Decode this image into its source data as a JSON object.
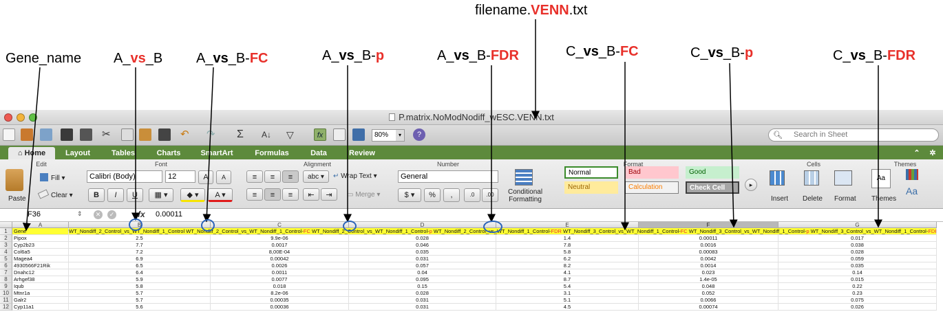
{
  "annotations": {
    "filename": {
      "prefix": "filename.",
      "hl": "VENN",
      ".suffix": "",
      "suffix": ".txt"
    },
    "gene_name": "Gene_name",
    "a_vs_b": {
      "p1": "A_",
      "hl": "vs",
      "p2": "_B"
    },
    "a_vs_b_fc": {
      "p1": "A_",
      "vs": "vs",
      "p2": "_B-",
      "hl": "FC"
    },
    "a_vs_b_p": {
      "p1": "A_",
      "vs": "vs",
      "p2": "_B-",
      "hl": "p"
    },
    "a_vs_b_fdr": {
      "p1": "A_",
      "vs": "vs",
      "p2": "_B-",
      "hl": "FDR"
    },
    "c_vs_b_fc": {
      "p1": "C_",
      "vs": "vs",
      "p2": "_B-",
      "hl": "FC"
    },
    "c_vs_b_p": {
      "p1": "C_",
      "vs": "vs",
      "p2": "_B-",
      "hl": "p"
    },
    "c_vs_b_fdr": {
      "p1": "C_",
      "vs": "vs",
      "p2": "_B-",
      "hl": "FDR"
    }
  },
  "window": {
    "title": "P.matrix.NoModNodiff_wESC.VENN.txt",
    "zoom": "80%",
    "search_placeholder": "Search in Sheet"
  },
  "tabs": [
    "Home",
    "Layout",
    "Tables",
    "Charts",
    "SmartArt",
    "Formulas",
    "Data",
    "Review"
  ],
  "ribbon": {
    "edit": {
      "title": "Edit",
      "fill": "Fill",
      "clear": "Clear",
      "paste": "Paste"
    },
    "font": {
      "title": "Font",
      "name": "Calibri (Body)",
      "size": "12",
      "bold": "B",
      "italic": "I",
      "underline": "U"
    },
    "alignment": {
      "title": "Alignment",
      "wrap": "Wrap Text",
      "merge": "Merge",
      "abc": "abc"
    },
    "number": {
      "title": "Number",
      "format": "General",
      "percent": "%",
      "comma": ","
    },
    "format": {
      "title": "Format",
      "conditional": "Conditional",
      "formatting": "Formatting",
      "styles": [
        {
          "label": "Normal",
          "bg": "#ffffff",
          "fg": "#000000",
          "border": "#3a8a2a"
        },
        {
          "label": "Bad",
          "bg": "#ffc7ce",
          "fg": "#9c0006",
          "border": "#ffc7ce"
        },
        {
          "label": "Good",
          "bg": "#c6efce",
          "fg": "#006100",
          "border": "#c6efce"
        },
        {
          "label": "Neutral",
          "bg": "#ffeb9c",
          "fg": "#9c6500",
          "border": "#ffeb9c"
        },
        {
          "label": "Calculation",
          "bg": "#f2f2f2",
          "fg": "#fa7d00",
          "border": "#7f7f7f"
        },
        {
          "label": "Check Cell",
          "bg": "#a5a5a5",
          "fg": "#ffffff",
          "border": "#3f3f3f"
        }
      ]
    },
    "cells": {
      "title": "Cells",
      "insert": "Insert",
      "delete": "Delete",
      "format": "Format"
    },
    "themes": {
      "title": "Themes",
      "themes": "Themes",
      "aa": "Aa"
    }
  },
  "formula_bar": {
    "cell_ref": "F36",
    "fx": "fx",
    "value": "0.00011"
  },
  "columns": [
    "A",
    "B",
    "C",
    "D",
    "E",
    "F",
    "G"
  ],
  "header_row": {
    "A": "Gene",
    "B": "WT_Nondiff_2_Control_vs_WT_Nondiff_1_Control",
    "C_pre": "WT_Nondiff_2_Control_vs_WT_Nondiff_1_Control-",
    "C_red": "FC",
    "D_pre": "WT_Nondiff_2_Control_vs_WT_Nondiff_1_Control-",
    "D_red": "p",
    "E_pre": "WT_Nondiff_2_Control_vs_WT_Nondiff_1_Control-",
    "E_red": "FDR",
    "F_pre": "WT_Nondiff_3_Control_vs_WT_Nondiff_1_Control-",
    "F_red": "FC",
    "G_pre": "WT_Nondiff_3_Control_vs_WT_Nondiff_1_Control-",
    "G_red": "p",
    "H_pre": "WT_Nondiff_3_Control_vs_WT_Nondiff_1_Control-",
    "H_red": "FDR"
  },
  "rows": [
    {
      "n": "2",
      "gene": "Pipox",
      "b": "2.5",
      "c": "9.9e-06",
      "d": "0.028",
      "e": "1.4",
      "f": "0.00011",
      "g": "0.017"
    },
    {
      "n": "3",
      "gene": "Cyp2b23",
      "b": "7.7",
      "c": "0.0017",
      "d": "0.046",
      "e": "7.8",
      "f": "0.0016",
      "g": "0.038"
    },
    {
      "n": "4",
      "gene": "Col6a5",
      "b": "7.2",
      "c": "8,00E-04",
      "d": "0.035",
      "e": "5.8",
      "f": "0.00083",
      "g": "0.028"
    },
    {
      "n": "5",
      "gene": "Magea4",
      "b": "6.9",
      "c": "0.00042",
      "d": "0.031",
      "e": "6.2",
      "f": "0.0042",
      "g": "0.059"
    },
    {
      "n": "6",
      "gene": "4930566F21Rik",
      "b": "6.5",
      "c": "0.0026",
      "d": "0.057",
      "e": "8.2",
      "f": "0.0014",
      "g": "0.035"
    },
    {
      "n": "7",
      "gene": "Dnahc12",
      "b": "6.4",
      "c": "0.0011",
      "d": "0.04",
      "e": "4.1",
      "f": "0.023",
      "g": "0.14"
    },
    {
      "n": "8",
      "gene": "Arhgef38",
      "b": "5.9",
      "c": "0.0077",
      "d": "0.095",
      "e": "8.7",
      "f": "1.4e-05",
      "g": "0.015"
    },
    {
      "n": "9",
      "gene": "Iqub",
      "b": "5.8",
      "c": "0.018",
      "d": "0.15",
      "e": "5.4",
      "f": "0.048",
      "g": "0.22"
    },
    {
      "n": "10",
      "gene": "Mtnr1a",
      "b": "5.7",
      "c": "8.2e-06",
      "d": "0.028",
      "e": "3.1",
      "f": "0.052",
      "g": "0.23"
    },
    {
      "n": "11",
      "gene": "Galr2",
      "b": "5.7",
      "c": "0.00035",
      "d": "0.031",
      "e": "5.1",
      "f": "0.0066",
      "g": "0.075"
    },
    {
      "n": "12",
      "gene": "Cyp11a1",
      "b": "5.6",
      "c": "0.00036",
      "d": "0.031",
      "e": "4.5",
      "f": "0.00074",
      "g": "0.026"
    }
  ]
}
